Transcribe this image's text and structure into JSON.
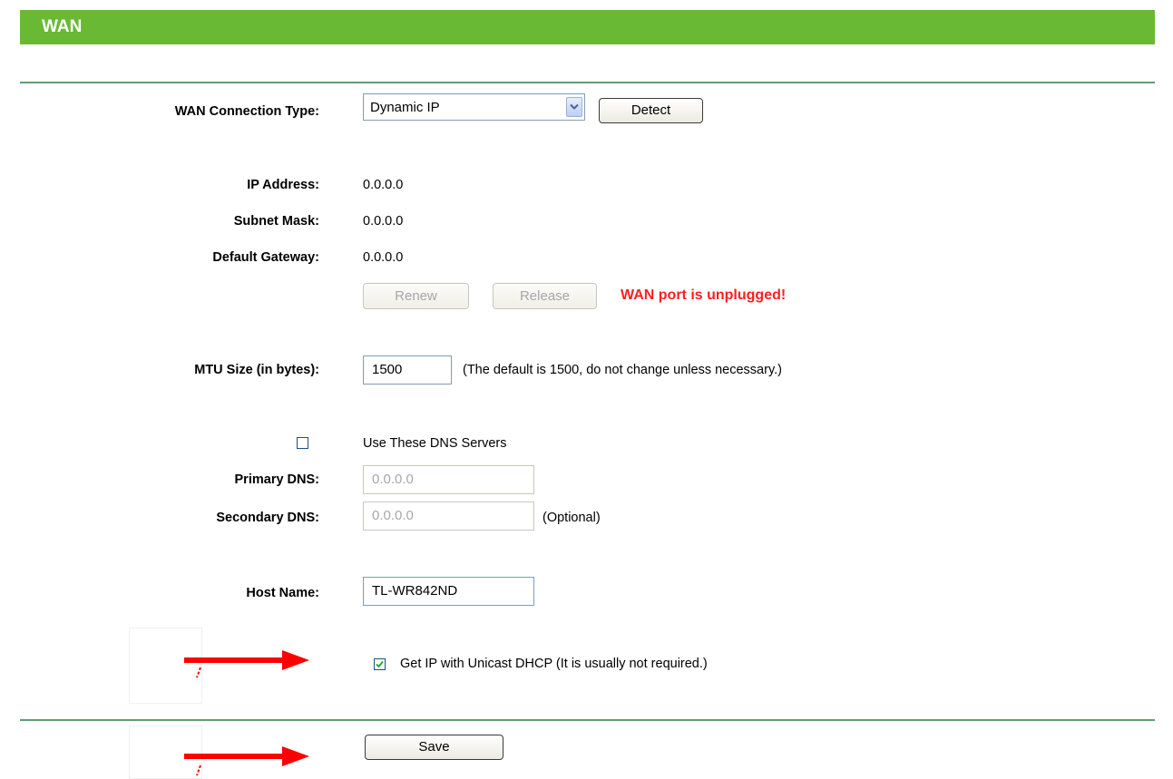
{
  "header": {
    "title": "WAN"
  },
  "connection": {
    "label": "WAN Connection Type:",
    "selected": "Dynamic IP",
    "detect_label": "Detect"
  },
  "status": {
    "ip_label": "IP Address:",
    "ip_value": "0.0.0.0",
    "subnet_label": "Subnet Mask:",
    "subnet_value": "0.0.0.0",
    "gateway_label": "Default Gateway:",
    "gateway_value": "0.0.0.0",
    "renew_label": "Renew",
    "release_label": "Release",
    "warning": "WAN port is unplugged!"
  },
  "mtu": {
    "label": "MTU Size (in bytes):",
    "value": "1500",
    "hint": "(The default is 1500, do not change unless necessary.)"
  },
  "dns": {
    "use_label": "Use These DNS Servers",
    "use_checked": false,
    "primary_label": "Primary DNS:",
    "primary_value": "0.0.0.0",
    "secondary_label": "Secondary DNS:",
    "secondary_value": "0.0.0.0",
    "optional": "(Optional)"
  },
  "host": {
    "label": "Host Name:",
    "value": "TL-WR842ND"
  },
  "unicast": {
    "label": "Get IP with Unicast DHCP (It is usually not required.)",
    "checked": true
  },
  "actions": {
    "save_label": "Save"
  },
  "colors": {
    "header_bg": "#6ab935",
    "divider": "#5f9e6e",
    "warning": "#ff1f1f",
    "annotation_arrow": "#ff0000"
  },
  "icons": {
    "dropdown": "chevron-down-icon",
    "check": "check-icon",
    "annotation": "red-arrow-icon"
  }
}
